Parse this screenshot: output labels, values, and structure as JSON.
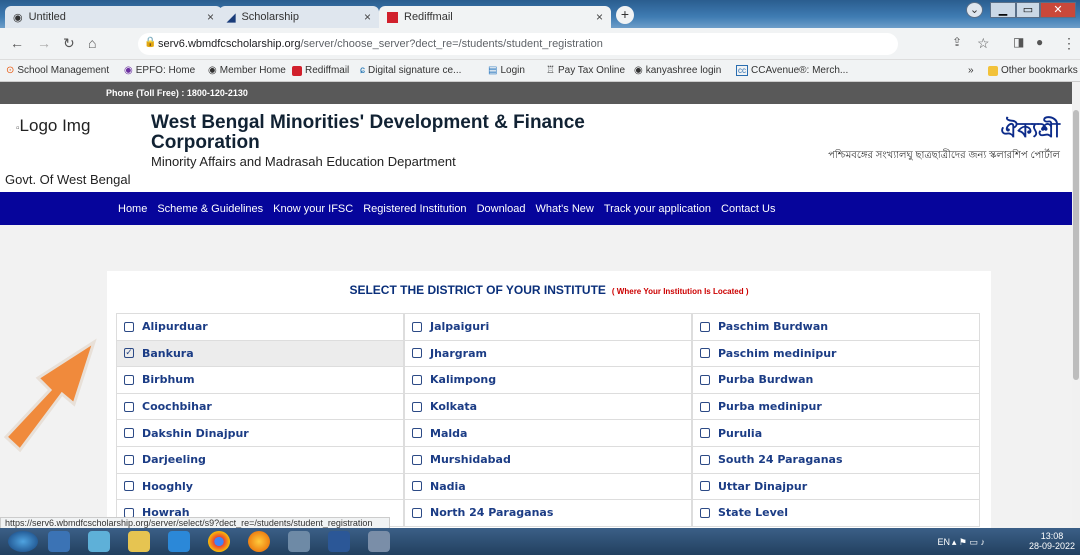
{
  "browser": {
    "tabs": [
      {
        "title": "Untitled"
      },
      {
        "title": "Scholarship"
      },
      {
        "title": "Rediffmail"
      }
    ],
    "url_host": "serv6.wbmdfcscholarship.org",
    "url_path": "/server/choose_server?dect_re=/students/student_registration",
    "bookmarks": [
      "School Management",
      "EPFO: Home",
      "Member Home",
      "Rediffmail",
      "Digital signature ce...",
      "Login",
      "Pay Tax Online",
      "kanyashree login",
      "CCAvenue®: Merch..."
    ],
    "other_bookmarks": "Other bookmarks",
    "more": "»",
    "status_url": "https://serv6.wbmdfcscholarship.org/server/select/s9?dect_re=/students/student_registration"
  },
  "site": {
    "phone": "Phone (Toll Free) : 1800-120-2130",
    "logo_alt": "Logo Img",
    "org_name": "West Bengal Minorities' Development & Finance Corporation",
    "dept": "Minority Affairs and Madrasah Education Department",
    "govt": "Govt. Of West Bengal",
    "brand": "ঐক্যশ্রী",
    "brand_sub": "পশ্চিমবঙ্গের সংখ্যালঘু ছাত্রছাত্রীদের জন্য স্কলারশিপ পোর্টাল"
  },
  "menu": [
    "Home",
    "Scheme & Guidelines",
    "Know your IFSC",
    "Registered Institution",
    "Download",
    "What's New",
    "Track your application",
    "Contact Us"
  ],
  "panel": {
    "title": "SELECT THE DISTRICT OF YOUR INSTITUTE",
    "note": "( Where Your Institution Is Located )"
  },
  "districts": [
    [
      "Alipurduar",
      "Jalpaiguri",
      "Paschim Burdwan"
    ],
    [
      "Bankura",
      "Jhargram",
      "Paschim medinipur"
    ],
    [
      "Birbhum",
      "Kalimpong",
      "Purba Burdwan"
    ],
    [
      "Coochbihar",
      "Kolkata",
      "Purba medinipur"
    ],
    [
      "Dakshin Dinajpur",
      "Malda",
      "Purulia"
    ],
    [
      "Darjeeling",
      "Murshidabad",
      "South 24 Paraganas"
    ],
    [
      "Hooghly",
      "Nadia",
      "Uttar Dinajpur"
    ],
    [
      "Howrah",
      "North 24 Paraganas",
      "State Level"
    ]
  ],
  "selected": "Bankura",
  "tray": {
    "lang": "EN",
    "time": "13:08",
    "date": "28-09-2022"
  }
}
